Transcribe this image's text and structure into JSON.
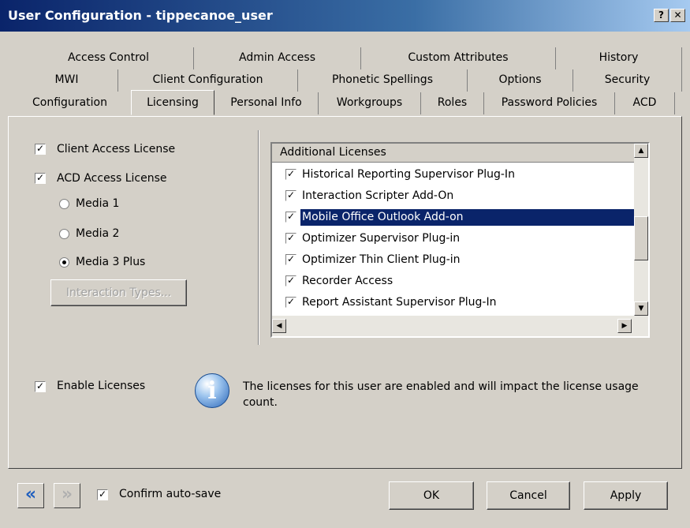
{
  "window": {
    "title": "User Configuration - tippecanoe_user",
    "help_btn": "?",
    "close_btn": "✕"
  },
  "tabs": {
    "row1": [
      "Access Control",
      "Admin Access",
      "Custom Attributes",
      "History"
    ],
    "row2": [
      "MWI",
      "Client Configuration",
      "Phonetic Spellings",
      "Options",
      "Security"
    ],
    "row3": [
      "Configuration",
      "Licensing",
      "Personal Info",
      "Workgroups",
      "Roles",
      "Password Policies",
      "ACD"
    ],
    "active": "Licensing"
  },
  "licensing": {
    "client_access_license": "Client Access License",
    "acd_access_license": "ACD Access License",
    "media1": "Media 1",
    "media2": "Media 2",
    "media3": "Media 3 Plus",
    "selected_media": "Media 3 Plus",
    "interaction_types": "Interaction Types...",
    "enable_licenses": "Enable Licenses",
    "info_text": "The licenses for this user are enabled and will impact the license usage count."
  },
  "additional_licenses": {
    "header": "Additional Licenses",
    "items": [
      {
        "label": "Historical Reporting Supervisor Plug-In",
        "checked": true
      },
      {
        "label": "Interaction Scripter Add-On",
        "checked": true
      },
      {
        "label": "Mobile Office Outlook Add-on",
        "checked": true,
        "selected": true
      },
      {
        "label": "Optimizer Supervisor Plug-in",
        "checked": true
      },
      {
        "label": "Optimizer Thin Client Plug-in",
        "checked": true
      },
      {
        "label": "Recorder Access",
        "checked": true
      },
      {
        "label": "Report Assistant Supervisor Plug-In",
        "checked": true
      }
    ]
  },
  "footer": {
    "confirm_autosave": "Confirm auto-save",
    "ok": "OK",
    "cancel": "Cancel",
    "apply": "Apply"
  },
  "icons": {
    "back": "double-left-arrow-icon",
    "forward": "double-right-arrow-icon",
    "info": "info-icon"
  },
  "colors": {
    "titlebar": "#0a246a",
    "selection": "#0a246a",
    "face": "#d4d0c8",
    "nav_blue": "#1f5fbf"
  }
}
